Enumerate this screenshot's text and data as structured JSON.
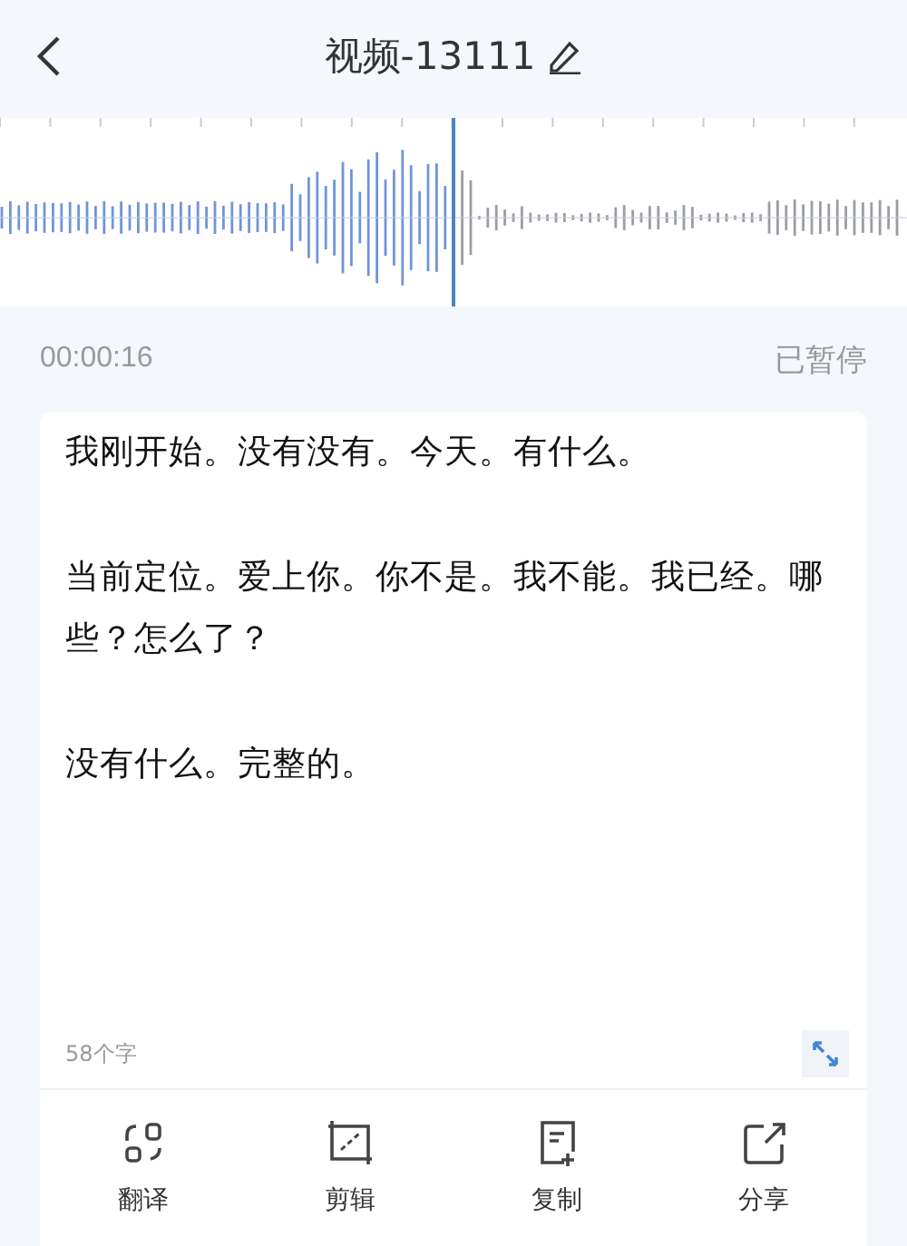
{
  "header": {
    "title": "视频-13111"
  },
  "playback": {
    "time": "00:00:16",
    "status": "已暂停"
  },
  "transcript": {
    "paragraphs": [
      "我刚开始。没有没有。今天。有什么。",
      "当前定位。爱上你。你不是。我不能。我已经。哪些？怎么了？",
      "没有什么。完整的。"
    ],
    "count": "58个字"
  },
  "actions": [
    {
      "label": "翻译",
      "kind": "translate"
    },
    {
      "label": "剪辑",
      "kind": "crop"
    },
    {
      "label": "复制",
      "kind": "copy"
    },
    {
      "label": "分享",
      "kind": "share"
    }
  ]
}
